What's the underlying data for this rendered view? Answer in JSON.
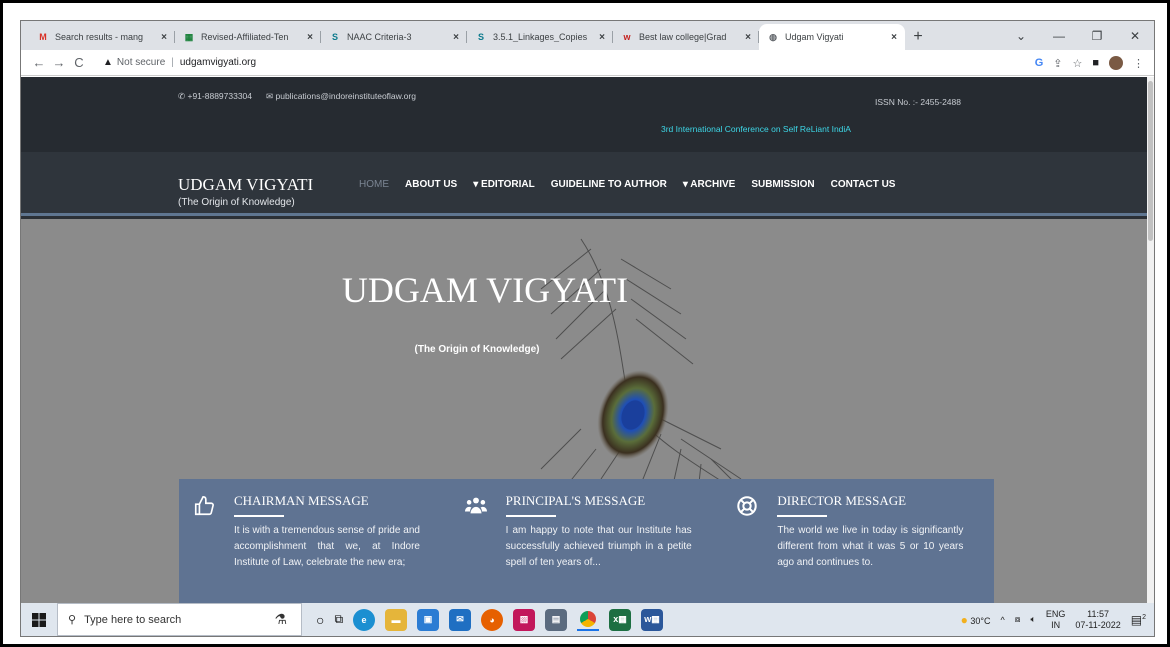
{
  "browser": {
    "tabs": [
      {
        "title": "Search results - mang",
        "favicon": "gmail-icon",
        "color": "#d93025",
        "glyph": "M"
      },
      {
        "title": "Revised-Affiliated-Ten",
        "favicon": "sheets-icon",
        "color": "#188038",
        "glyph": "▦"
      },
      {
        "title": "NAAC Criteria-3",
        "favicon": "sharepoint-icon",
        "color": "#0b7a8c",
        "glyph": "S"
      },
      {
        "title": "3.5.1_Linkages_Copies",
        "favicon": "sharepoint-icon",
        "color": "#0b7a8c",
        "glyph": "S"
      },
      {
        "title": "Best law college|Grad",
        "favicon": "college-icon",
        "color": "#c5221f",
        "glyph": "w"
      },
      {
        "title": "Udgam Vigyati",
        "favicon": "globe-icon",
        "color": "#5f6368",
        "glyph": "◍",
        "active": true
      }
    ],
    "new_tab": "+",
    "address": {
      "security": "Not secure",
      "url": "udgamvigyati.org"
    }
  },
  "site": {
    "topbar": {
      "phone": "+91-8889733304",
      "email": "publications@indoreinstituteoflaw.org",
      "issn": "ISSN No. :- 2455-2488",
      "conference": "3rd International Conference on Self ReLiant IndiA"
    },
    "brand": {
      "name": "UDGAM VIGYATI",
      "tagline": "(The Origin of Knowledge)"
    },
    "menu": {
      "home": "HOME",
      "about": "ABOUT US",
      "editorial": "▾ EDITORIAL",
      "guideline": "GUIDELINE TO AUTHOR",
      "archive": "▾ ARCHIVE",
      "submission": "SUBMISSION",
      "contact": "CONTACT US"
    },
    "hero": {
      "title": "UDGAM VIGYATI",
      "subtitle": "(The Origin of Knowledge)"
    },
    "messages": [
      {
        "title": "CHAIRMAN MESSAGE",
        "icon": "thumbs-up-icon",
        "text": "It is with a tremendous sense of pride and accomplishment that we, at Indore Institute of Law, celebrate the new era;"
      },
      {
        "title": "PRINCIPAL'S MESSAGE",
        "icon": "users-icon",
        "text": "I am happy to note that our Institute has successfully achieved triumph in a petite spell of ten years of..."
      },
      {
        "title": "DIRECTOR MESSAGE",
        "icon": "lifebuoy-icon",
        "text": "The world we live in today is significantly different from what it was 5 or 10 years ago and continues to."
      }
    ]
  },
  "taskbar": {
    "search_placeholder": "Type here to search",
    "weather": "30°C",
    "lang_top": "ENG",
    "lang_bottom": "IN",
    "time": "11:57",
    "date": "07-11-2022",
    "notifications": "2"
  }
}
